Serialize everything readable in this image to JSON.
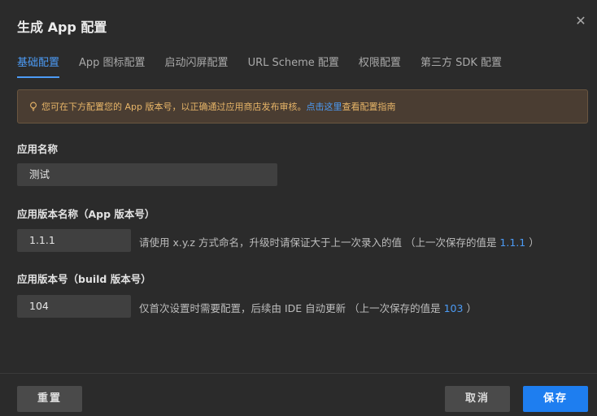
{
  "dialog": {
    "title": "生成 App 配置",
    "close_icon": "close-icon"
  },
  "tabs": [
    {
      "label": "基础配置",
      "active": true
    },
    {
      "label": "App 图标配置",
      "active": false
    },
    {
      "label": "启动闪屏配置",
      "active": false
    },
    {
      "label": "URL Scheme 配置",
      "active": false
    },
    {
      "label": "权限配置",
      "active": false
    },
    {
      "label": "第三方 SDK 配置",
      "active": false
    }
  ],
  "notice": {
    "icon": "lightbulb-icon",
    "text": "您可在下方配置您的 App 版本号，以正确通过应用商店发布审核。",
    "link": "点击这里",
    "suffix": "查看配置指南"
  },
  "fields": {
    "app_name": {
      "label": "应用名称",
      "value": "测试"
    },
    "version_name": {
      "label": "应用版本名称（App 版本号）",
      "value": "1.1.1",
      "hint_prefix": "请使用 x.y.z 方式命名，升级时请保证大于上一次录入的值 （上一次保存的值是 ",
      "hint_value": "1.1.1",
      "hint_suffix": " ）"
    },
    "version_code": {
      "label": "应用版本号（build 版本号）",
      "value": "104",
      "hint_prefix": "仅首次设置时需要配置，后续由 IDE 自动更新 （上一次保存的值是 ",
      "hint_value": "103",
      "hint_suffix": " ）"
    }
  },
  "footer": {
    "reset_label": "重置",
    "cancel_label": "取消",
    "save_label": "保存"
  },
  "colors": {
    "background": "#2b2b2b",
    "accent": "#4c9bf5",
    "primary_button": "#1e7ef0",
    "notice_bg": "#4a3d32",
    "notice_text": "#e7b568"
  }
}
